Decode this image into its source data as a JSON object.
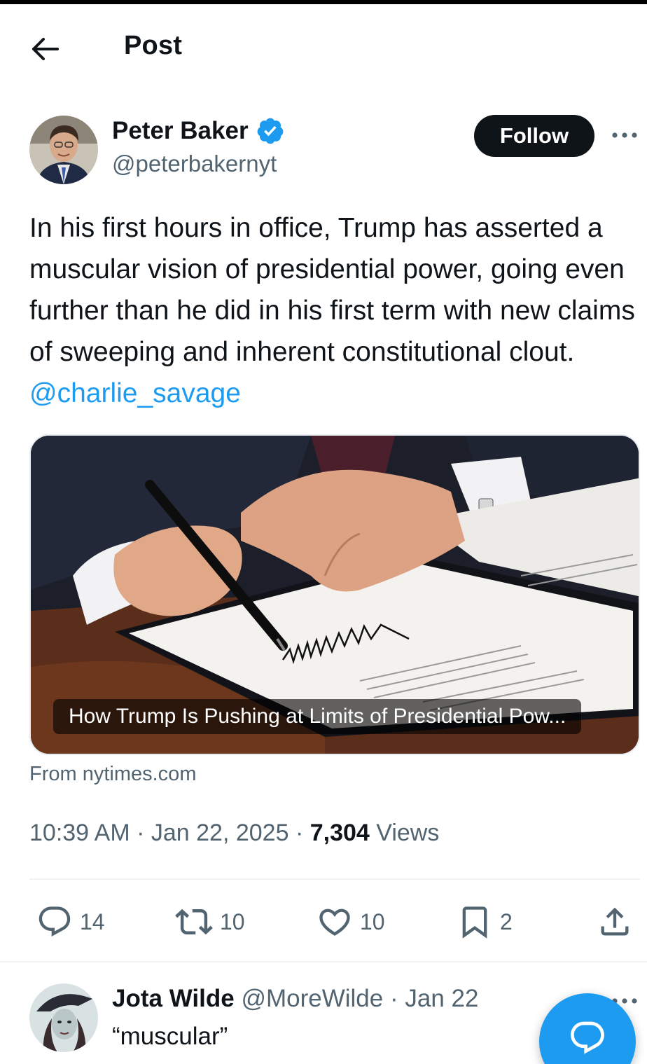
{
  "header": {
    "title": "Post"
  },
  "author": {
    "name": "Peter Baker",
    "handle": "@peterbakernyt",
    "follow_label": "Follow"
  },
  "post": {
    "text": "In his first hours in office, Trump has asserted a muscular vision of presidential power, going even further than he did in his first term with new claims of sweeping and inherent constitutional clout.",
    "mention": "@charlie_savage"
  },
  "card": {
    "caption": "How Trump Is Pushing at Limits of Presidential Pow...",
    "source": "From nytimes.com"
  },
  "meta": {
    "time": "10:39 AM",
    "date": "Jan 22, 2025",
    "views_count": "7,304",
    "views_label": "Views"
  },
  "actions": {
    "replies": "14",
    "reposts": "10",
    "likes": "10",
    "bookmarks": "2"
  },
  "reply": {
    "name": "Jota Wilde",
    "handle": "@MoreWilde",
    "date": "Jan 22",
    "text": "“muscular”"
  },
  "colors": {
    "accent": "#1d9bf0",
    "text": "#0f1419",
    "secondary": "#536471"
  },
  "icons": [
    "back-arrow-icon",
    "verified-badge-icon",
    "more-icon",
    "reply-icon",
    "repost-icon",
    "like-icon",
    "bookmark-icon",
    "share-icon",
    "compose-reply-icon"
  ]
}
